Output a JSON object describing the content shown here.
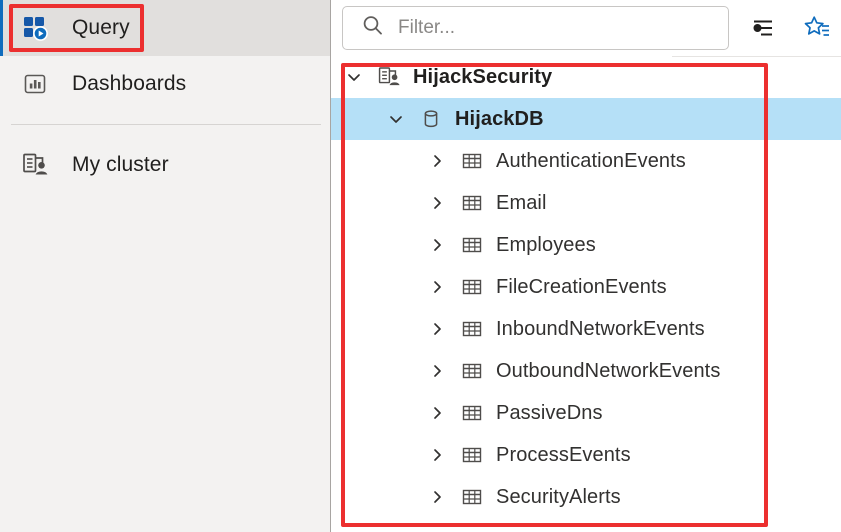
{
  "sidebar": {
    "items": [
      {
        "label": "Query",
        "icon": "query-grid-play-icon",
        "selected": true
      },
      {
        "label": "Dashboards",
        "icon": "dashboard-bar-chart-icon",
        "selected": false
      },
      {
        "label": "My cluster",
        "icon": "cluster-user-icon",
        "selected": false
      }
    ]
  },
  "toolbar": {
    "filter_placeholder": "Filter...",
    "filter_value": "",
    "search_icon": "search-icon",
    "settings_icon": "filter-settings-icon",
    "favorites_icon": "star-favorites-icon"
  },
  "tree": {
    "cluster": {
      "label": "HijackSecurity",
      "icon": "cluster-user-icon",
      "expanded": true,
      "chevron": "chevron-down-icon"
    },
    "database": {
      "label": "HijackDB",
      "icon": "database-cylinder-icon",
      "expanded": true,
      "selected": true,
      "chevron": "chevron-down-icon"
    },
    "tables": [
      {
        "label": "AuthenticationEvents",
        "icon": "table-grid-icon",
        "chevron": "chevron-right-icon"
      },
      {
        "label": "Email",
        "icon": "table-grid-icon",
        "chevron": "chevron-right-icon"
      },
      {
        "label": "Employees",
        "icon": "table-grid-icon",
        "chevron": "chevron-right-icon"
      },
      {
        "label": "FileCreationEvents",
        "icon": "table-grid-icon",
        "chevron": "chevron-right-icon"
      },
      {
        "label": "InboundNetworkEvents",
        "icon": "table-grid-icon",
        "chevron": "chevron-right-icon"
      },
      {
        "label": "OutboundNetworkEvents",
        "icon": "table-grid-icon",
        "chevron": "chevron-right-icon"
      },
      {
        "label": "PassiveDns",
        "icon": "table-grid-icon",
        "chevron": "chevron-right-icon"
      },
      {
        "label": "ProcessEvents",
        "icon": "table-grid-icon",
        "chevron": "chevron-right-icon"
      },
      {
        "label": "SecurityAlerts",
        "icon": "table-grid-icon",
        "chevron": "chevron-right-icon"
      }
    ]
  },
  "colors": {
    "accent_blue": "#0f6cbd",
    "selection_blue": "#b5e0f7",
    "annotation_red": "#ec2f2f",
    "sidebar_bg": "#f3f2f1",
    "selected_nav_bg": "#e1dfdd"
  }
}
